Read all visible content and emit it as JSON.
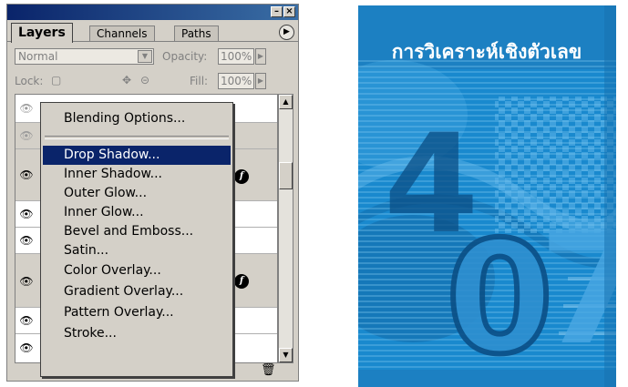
{
  "palette": {
    "tabs": [
      "Layers",
      "Channels",
      "Paths"
    ],
    "blend_mode": "Normal",
    "opacity_label": "Opacity:",
    "opacity_value": "100%",
    "lock_label": "Lock:",
    "fill_label": "Fill:",
    "fill_value": "100%"
  },
  "context_menu": {
    "items": [
      "Blending Options...",
      "Drop Shadow...",
      "Inner Shadow...",
      "Outer Glow...",
      "Inner Glow...",
      "Bevel and Emboss...",
      "Satin...",
      "Color Overlay...",
      "Gradient Overlay...",
      "Pattern Overlay...",
      "Stroke..."
    ],
    "highlighted": "Drop Shadow..."
  },
  "cover": {
    "title": "การวิเคราะห์เชิงตัวเลข",
    "digits": [
      "4",
      "0",
      "7"
    ],
    "colors": {
      "background": "#1f8cd0",
      "title": "#ffffff"
    }
  },
  "colors": {
    "palette_bg": "#d4d0c8",
    "titlebar": "#0a246a",
    "menu_highlight": "#0a246a"
  }
}
